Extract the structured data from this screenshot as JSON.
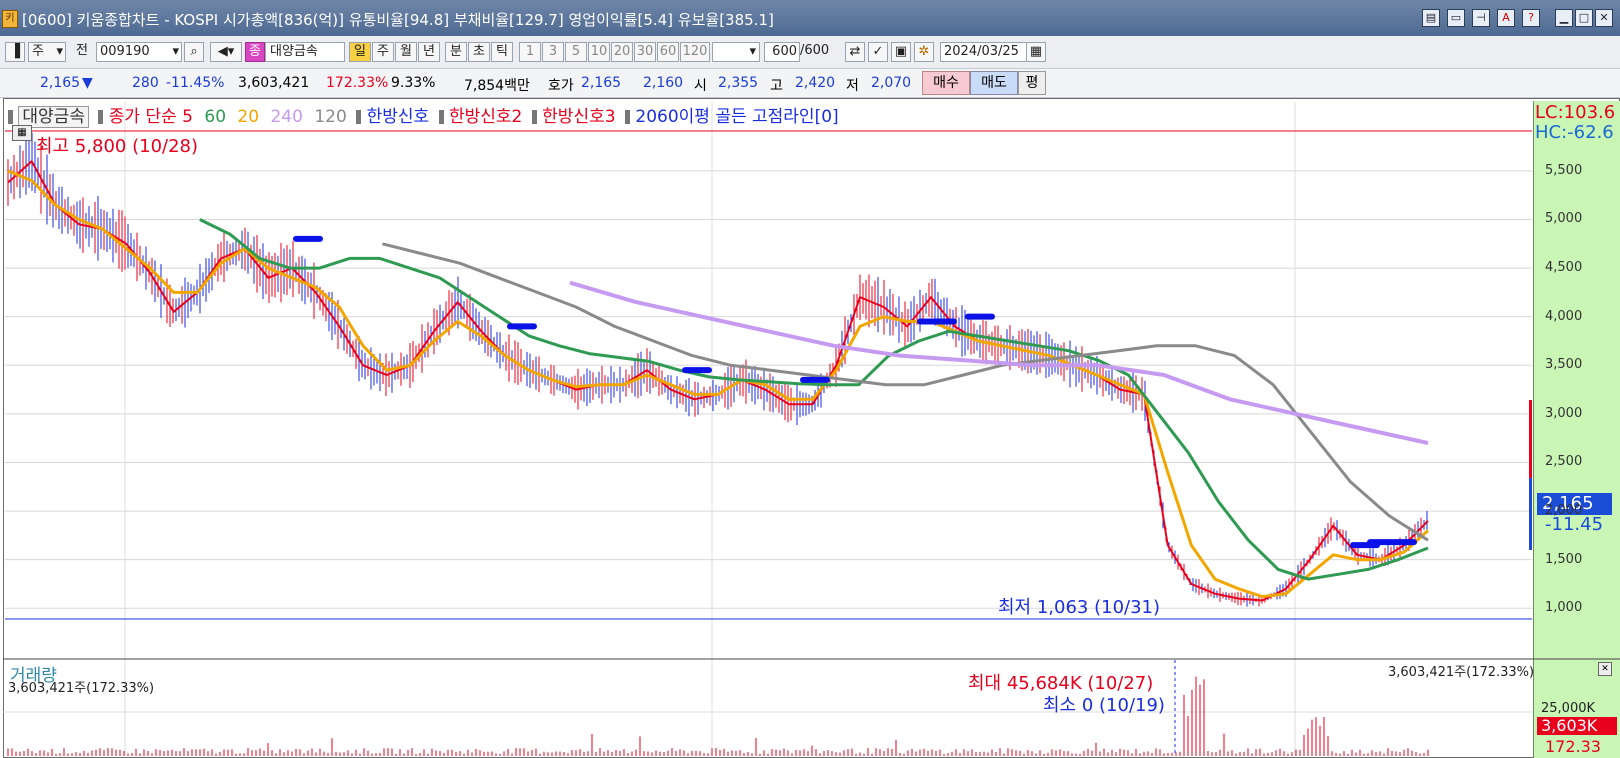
{
  "window": {
    "title": "[0600] 키움종합차트 - KOSPI 시가총액[836(억)] 유통비율[94.8] 부채비율[129.7] 영업이익률[5.4] 유보율[385.1]",
    "app_icon": "kiwoom-app-icon"
  },
  "toolbar": {
    "period_select": "주",
    "prev_label": "전",
    "code": "009190",
    "stock_badge": "종",
    "stock_name": "대양금속",
    "intervals": [
      "일",
      "주",
      "월",
      "년",
      "분",
      "초",
      "틱"
    ],
    "active_interval": "일",
    "minute_options": [
      "1",
      "3",
      "5",
      "10",
      "20",
      "30",
      "60",
      "120"
    ],
    "count": "600",
    "total": "/600",
    "date": "2024/03/25"
  },
  "ticker": {
    "price": "2,165",
    "down_arrow": "▼",
    "change": "280",
    "change_pct": "-11.45%",
    "volume": "3,603,421",
    "volume_ratio": "172.33%",
    "turnover": "9.33%",
    "amount": "7,854백만",
    "quote_label": "호가",
    "ask": "2,165",
    "bid": "2,160",
    "open_label": "시",
    "open": "2,355",
    "high_label": "고",
    "high": "2,420",
    "low_label": "저",
    "low": "2,070",
    "buy_button": "매수",
    "sell_button": "매도",
    "eval_button": "평"
  },
  "legend": {
    "stock": "대양금속",
    "ma_label": "종가 단순 5",
    "ma60": "60",
    "ma20": "20",
    "ma240": "240",
    "ma120": "120",
    "sig1": "한방신호",
    "sig2": "한방신호2",
    "sig3": "한방신호3",
    "golden": "2060이평 골든 고점라인[0]"
  },
  "annotations": {
    "high": "최고 5,800 (10/28)",
    "low": "최저 1,063 (10/31)",
    "lc": "LC:103.6",
    "hc": "HC:-62.6",
    "current_price": "2,165",
    "current_pct": "-11.45",
    "vol_title": "거래량",
    "vol_left": "3,603,421주(172.33%)",
    "vol_right": "3,603,421주(172.33%)",
    "vol_max": "최대 45,684K (10/27)",
    "vol_min": "최소 0 (10/19)",
    "vol_axis": "25,000K",
    "vol_current": "3,603K",
    "vol_pct": "172.33"
  },
  "colors": {
    "ma5": "#e8001c",
    "ma20": "#f2a600",
    "ma60": "#2e9a52",
    "ma120": "#8a8a8a",
    "ma240": "#c79af2",
    "signal": "#0a12e8",
    "axis_bg": "#c9f5b5"
  },
  "chart_data": {
    "type": "line",
    "y_axis": {
      "ticks": [
        "5,500",
        "5,000",
        "4,500",
        "4,000",
        "3,500",
        "3,000",
        "2,500",
        "2,000",
        "1,500",
        "1,000"
      ],
      "range": [
        900,
        5900
      ]
    },
    "series": [
      {
        "name": "5",
        "values": [
          5380,
          5600,
          5150,
          4950,
          4900,
          4750,
          4450,
          4050,
          4250,
          4600,
          4700,
          4400,
          4500,
          4250,
          3900,
          3500,
          3400,
          3500,
          3850,
          4150,
          3850,
          3600,
          3450,
          3350,
          3250,
          3300,
          3300,
          3450,
          3250,
          3150,
          3200,
          3350,
          3250,
          3100,
          3100,
          3500,
          4200,
          4100,
          3900,
          4200,
          3900,
          3750,
          3700,
          3650,
          3600,
          3500,
          3400,
          3250,
          3200,
          1650,
          1250,
          1150,
          1100,
          1080,
          1200,
          1500,
          1850,
          1550,
          1500,
          1650,
          1900
        ]
      },
      {
        "name": "20",
        "values": [
          5500,
          5400,
          5150,
          5000,
          4900,
          4700,
          4500,
          4250,
          4250,
          4550,
          4700,
          4500,
          4400,
          4300,
          4100,
          3700,
          3450,
          3500,
          3750,
          3950,
          3800,
          3600,
          3450,
          3350,
          3280,
          3300,
          3300,
          3400,
          3300,
          3200,
          3200,
          3350,
          3300,
          3150,
          3150,
          3450,
          3900,
          4000,
          3950,
          3950,
          3850,
          3750,
          3700,
          3650,
          3600,
          3500,
          3400,
          3300,
          3200,
          2400,
          1650,
          1300,
          1200,
          1120,
          1150,
          1350,
          1550,
          1500,
          1500,
          1580,
          1800
        ]
      },
      {
        "name": "60",
        "values": [
          null,
          null,
          null,
          null,
          5000,
          4850,
          4600,
          4500,
          4500,
          4600,
          4600,
          4500,
          4400,
          4200,
          4000,
          3800,
          3700,
          3620,
          3580,
          3540,
          3450,
          3380,
          3350,
          3330,
          3310,
          3300,
          3300,
          3600,
          3750,
          3850,
          3800,
          3750,
          3700,
          3650,
          3550,
          3400,
          3000,
          2600,
          2100,
          1700,
          1400,
          1300,
          1350,
          1400,
          1500,
          1620
        ]
      },
      {
        "name": "120",
        "values": [
          null,
          null,
          null,
          null,
          null,
          null,
          4750,
          4650,
          4550,
          4400,
          4250,
          4100,
          3900,
          3750,
          3600,
          3500,
          3450,
          3400,
          3350,
          3300,
          3300,
          3400,
          3500,
          3550,
          3600,
          3650,
          3700,
          3700,
          3600,
          3300,
          2800,
          2300,
          1950,
          1700
        ]
      },
      {
        "name": "240",
        "values": [
          4350,
          4150,
          4000,
          3850,
          3700,
          3600,
          3550,
          3500,
          3500,
          3400,
          3150,
          3000,
          2850,
          2700
        ]
      }
    ],
    "markers": [
      {
        "name": "한방신호",
        "values": [
          4800,
          3900,
          3450,
          3350,
          3950,
          4000,
          1650,
          1680
        ]
      }
    ],
    "highest": {
      "value": 5800,
      "date": "10/28"
    },
    "lowest": {
      "value": 1063,
      "date": "10/31"
    },
    "volume": {
      "max": "45,684K",
      "min": "0",
      "current": "3,603K"
    }
  }
}
